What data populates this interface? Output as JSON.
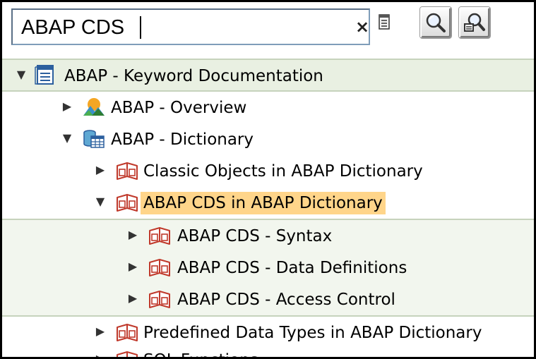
{
  "search": {
    "value": "ABAP CDS",
    "clear_symbol": "×"
  },
  "toolbar": {
    "history_icon": "document-icon",
    "find_icon": "magnifier-icon",
    "find_next_icon": "magnifier-next-icon"
  },
  "tree": {
    "root": {
      "label": "ABAP - Keyword Documentation",
      "expanded": true,
      "icon": "document-list-icon"
    },
    "nodes": [
      {
        "label": "ABAP - Overview",
        "expanded": false,
        "icon": "landscape-icon",
        "level": 1
      },
      {
        "label": "ABAP - Dictionary",
        "expanded": true,
        "icon": "database-table-icon",
        "level": 1
      },
      {
        "label": "Classic Objects in ABAP Dictionary",
        "expanded": false,
        "icon": "book-icon",
        "level": 2
      },
      {
        "label": "ABAP CDS in ABAP Dictionary",
        "expanded": true,
        "icon": "book-icon",
        "level": 2,
        "selected": true
      },
      {
        "label": "ABAP CDS - Syntax",
        "expanded": false,
        "icon": "book-icon",
        "level": 3
      },
      {
        "label": "ABAP CDS - Data Definitions",
        "expanded": false,
        "icon": "book-icon",
        "level": 3
      },
      {
        "label": "ABAP CDS - Access Control",
        "expanded": false,
        "icon": "book-icon",
        "level": 3
      },
      {
        "label": "Predefined Data Types in ABAP Dictionary",
        "expanded": false,
        "icon": "book-icon",
        "level": 2
      },
      {
        "label": "SQL Functions",
        "expanded": false,
        "icon": "book-icon",
        "level": 2
      }
    ]
  },
  "colors": {
    "selection": "#ffd58a",
    "root_row": "#e9f0e2",
    "separator": "#c6d3bc",
    "book_icon": "#c0392b"
  }
}
